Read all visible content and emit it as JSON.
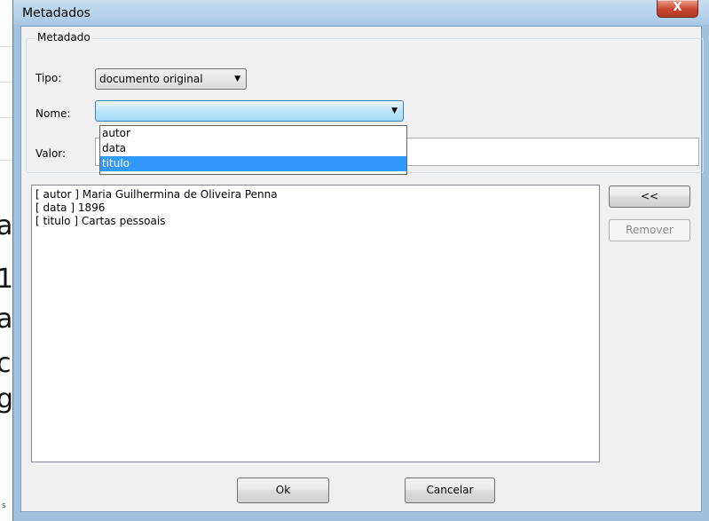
{
  "window": {
    "title": "Metadados",
    "close_glyph": "X"
  },
  "group": {
    "title": "Metadado"
  },
  "fields": {
    "tipo_label": "Tipo:",
    "tipo_value": "documento original",
    "nome_label": "Nome:",
    "nome_value": "",
    "valor_label": "Valor:",
    "valor_value": ""
  },
  "nome_options": [
    {
      "label": "autor",
      "selected": false
    },
    {
      "label": "data",
      "selected": false
    },
    {
      "label": "titulo",
      "selected": true
    }
  ],
  "metadata_entries": [
    "[ autor ] Maria Guilhermina de Oliveira Penna",
    "[ data ] 1896",
    "[ titulo ] Cartas pessoais"
  ],
  "buttons": {
    "add": "<<",
    "remove": "Remover",
    "ok": "Ok",
    "cancel": "Cancelar"
  },
  "background_doc": {
    "glyphs": [
      "a",
      "1",
      "a",
      "c",
      "g"
    ],
    "footer": "s"
  },
  "colors": {
    "selection": "#3399ff",
    "close_button": "#c8462f",
    "window_frame": "#9fc1de"
  }
}
